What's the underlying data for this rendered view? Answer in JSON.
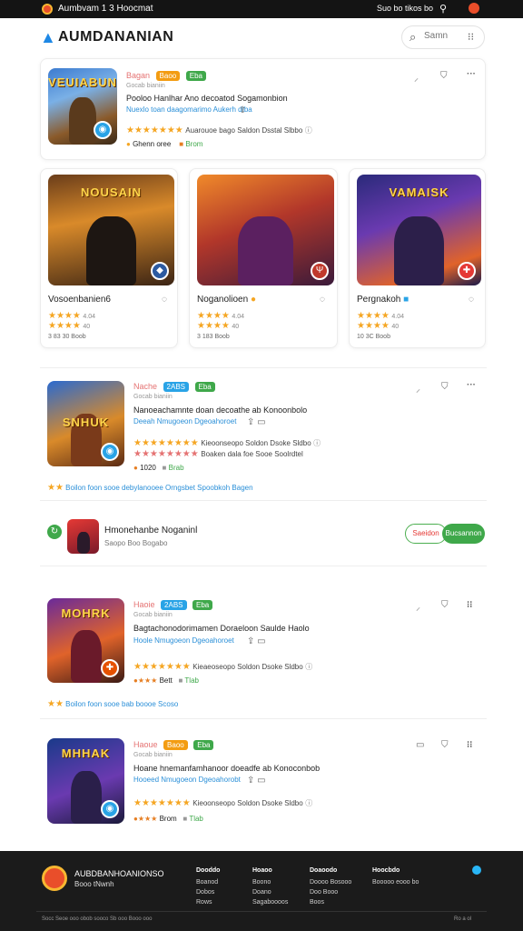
{
  "topbar": {
    "title": "Aumbvam 1 3 Hoocmat",
    "links": "Suo bo tikos bo"
  },
  "header": {
    "brand": "AUMDANANIAN",
    "search_placeholder": "Samn"
  },
  "featured": {
    "thumb_title": "VEUIABUN",
    "tags": [
      "Bagan",
      "Baoo",
      "Eba"
    ],
    "subtitle": "Gocab bianiin",
    "title": "Pooloo Hanlhar Ano decoatod Sogamonbion",
    "meta": "Nuexlo toan daagomarimo Aukerh dtba",
    "rating_text": "Auarouoe bago Saldon Dsstal Slbbo",
    "stat1": "Ghenn oree",
    "stat2": "Brom"
  },
  "grid_cards": [
    {
      "thumb_title": "NOUSAIN",
      "name": "Vosoenbanien6",
      "r1": "4.04",
      "r2": "40",
      "meta": "3 83 30 Boob"
    },
    {
      "thumb_title": "",
      "name": "Noganolioen",
      "r1": "4.04",
      "r2": "40",
      "meta": "3 183 Boob"
    },
    {
      "thumb_title": "VAMAISK",
      "name": "Pergnakoh",
      "r1": "4.04",
      "r2": "40",
      "meta": "10 3C Boob"
    }
  ],
  "list_items": [
    {
      "thumb_title": "SNHUK",
      "tags": [
        "Nache",
        "2ABS",
        "Eba"
      ],
      "subtitle": "Gocab bianiin",
      "title": "Nanoeachamnte doan decoathe ab Konoonbolo",
      "meta": "Deeah  Nmugoeon  Dgeoahoroet",
      "rating_text": "Kieoonseopo Soldon Dsoke Sldbo",
      "rating_text2": "Boaken dala foe Sooe Soolrdtel",
      "stat1": "1020",
      "stat2": "Brab",
      "footer_note": "Boilon foon sooe debylanooee Orngsbet Spoobkoh Bagen"
    },
    {
      "thumb_title": "MOHRK",
      "tags": [
        "Haoie",
        "2ABS",
        "Eba"
      ],
      "subtitle": "Gocab bianiin",
      "title": "Bagtachonodorimamen Doraeloon Saulde Haolo",
      "meta": "Hoole  Nmugoeon  Dgeoahoroet",
      "rating_text": "Kieaeoseopo Soldon Dsoke Sldbo",
      "stat1": "Bett",
      "stat2": "Tlab",
      "footer_note": "Boilon foon sooe bab boooe Scoso"
    },
    {
      "thumb_title": "MHHAK",
      "tags": [
        "Haoue",
        "Baoo",
        "Eba"
      ],
      "subtitle": "Gocab bianiin",
      "title": "Hoane hnemanfamhanoor doeadfe ab Konoconbob",
      "meta": "Hooeed  Nmugoeon  Dgeoahorobt",
      "rating_text": "Kieoonseopo Soldon Dsoke Sldbo",
      "stat1": "Brom",
      "stat2": "Tlab"
    }
  ],
  "promo": {
    "title": "Hmonehanbe Noganinl",
    "subtitle": "Saopo Boo Bogabo",
    "btn_secondary": "Saeidon",
    "btn_primary": "Bucsannon"
  },
  "footer": {
    "brand": "AUBDBANHOANIONSO",
    "brand2": "Booo tNwnh",
    "cols": [
      {
        "h": "Dooddo",
        "items": [
          "Boanod",
          "Dobos",
          "Rows"
        ]
      },
      {
        "h": "Hoaoo",
        "items": [
          "Boono",
          "Doano",
          "Sagaboooos"
        ]
      },
      {
        "h": "Doaoodo",
        "items": [
          "Doooo Bosooo",
          "Doo Booo",
          "Boos"
        ]
      },
      {
        "h": "Hoocbdo",
        "items": [
          "Booooo eooo bo"
        ]
      }
    ],
    "bottom": "Socc Seoe ooo obob sooco Sb ooo Booo ooo",
    "copy": "Ro a ol"
  },
  "colors": {
    "orange": "#f39c12",
    "blue": "#29a3e6",
    "green": "#3fa84a",
    "star": "#f5a623"
  }
}
